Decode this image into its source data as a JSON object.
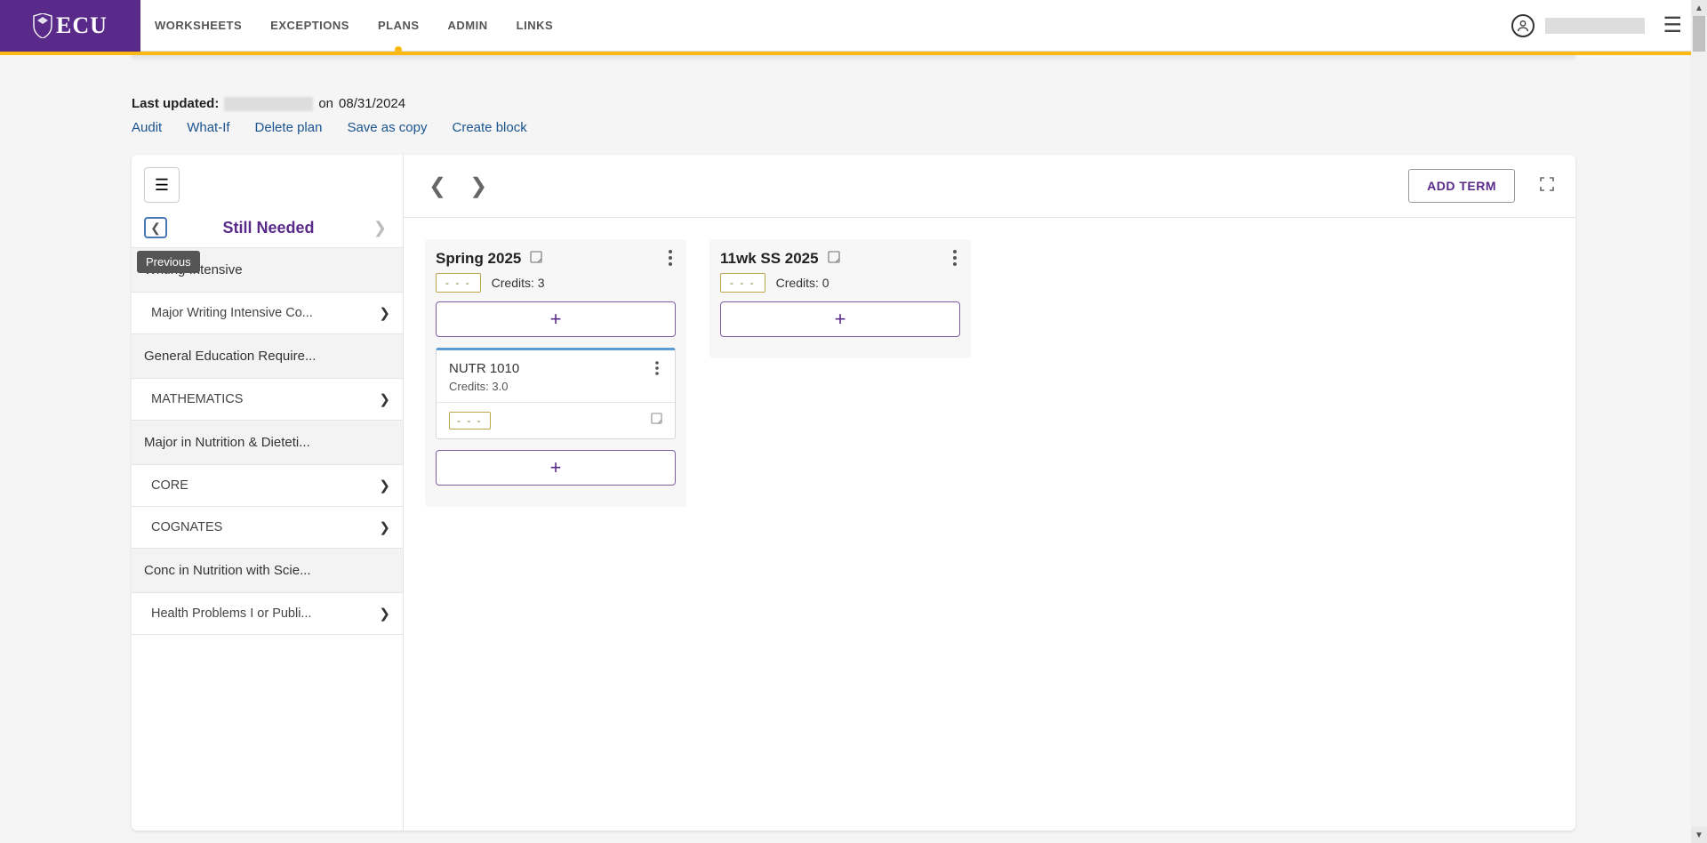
{
  "header": {
    "brand": "ECU",
    "nav": [
      {
        "label": "WORKSHEETS",
        "active": false
      },
      {
        "label": "EXCEPTIONS",
        "active": false
      },
      {
        "label": "PLANS",
        "active": true
      },
      {
        "label": "ADMIN",
        "active": false
      },
      {
        "label": "LINKS",
        "active": false
      }
    ]
  },
  "meta": {
    "last_updated_label": "Last updated:",
    "on_text": "on",
    "date": "08/31/2024"
  },
  "actions": {
    "audit": "Audit",
    "what_if": "What-If",
    "delete_plan": "Delete plan",
    "save_as_copy": "Save as copy",
    "create_block": "Create block"
  },
  "sidebar": {
    "title": "Still Needed",
    "prev_tooltip": "Previous",
    "groups": [
      {
        "header": "Writing Intensive",
        "items": [
          {
            "label": "Major Writing Intensive Co..."
          }
        ]
      },
      {
        "header": "General Education Require...",
        "items": [
          {
            "label": "MATHEMATICS"
          }
        ]
      },
      {
        "header": "Major in Nutrition & Dieteti...",
        "items": [
          {
            "label": "CORE"
          },
          {
            "label": "COGNATES"
          }
        ]
      },
      {
        "header": "Conc in Nutrition with Scie...",
        "items": [
          {
            "label": "Health Problems I or Publi..."
          }
        ]
      }
    ]
  },
  "plan": {
    "add_term_label": "ADD TERM",
    "terms": [
      {
        "title": "Spring 2025",
        "credits_label": "Credits:",
        "credits_value": "3",
        "status": "- - -",
        "courses": [
          {
            "name": "NUTR 1010",
            "credits_label": "Credits:",
            "credits_value": "3.0",
            "status": "- - -"
          }
        ]
      },
      {
        "title": "11wk SS 2025",
        "credits_label": "Credits:",
        "credits_value": "0",
        "status": "- - -",
        "courses": []
      }
    ]
  }
}
